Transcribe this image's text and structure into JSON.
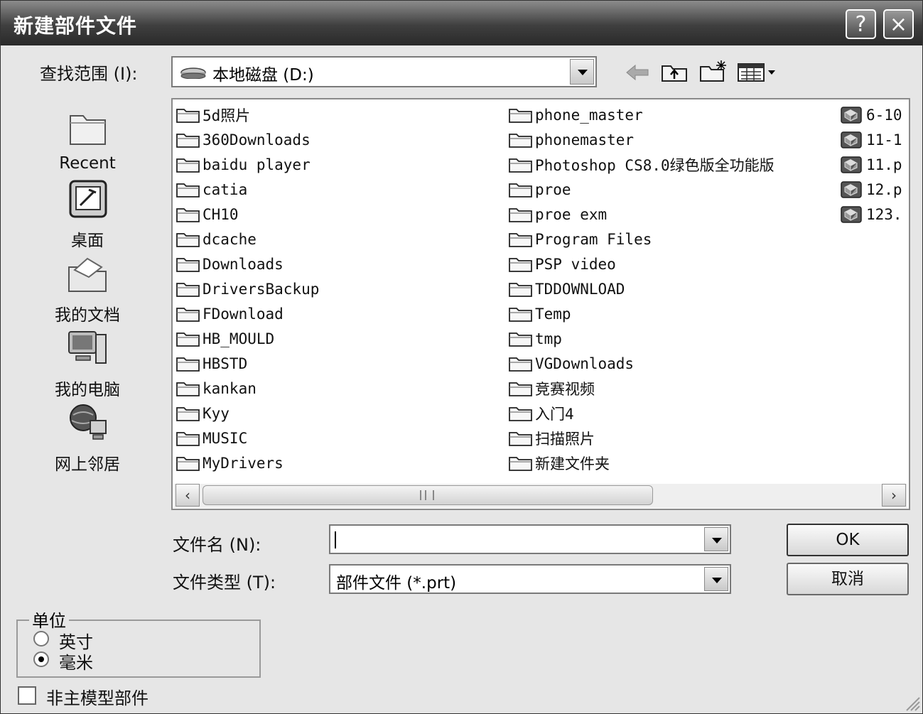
{
  "window": {
    "title": "新建部件文件",
    "help_label": "?",
    "close_label": "×"
  },
  "lookin": {
    "label": "查找范围 (I):",
    "value": "本地磁盘  (D:)"
  },
  "toolbar": {
    "back_icon": "back-arrow-icon",
    "up_icon": "up-folder-icon",
    "newfolder_icon": "new-folder-icon",
    "views_icon": "view-menu-icon"
  },
  "places": [
    {
      "label": "Recent",
      "icon": "recent-folder-icon"
    },
    {
      "label": "桌面",
      "icon": "desktop-icon"
    },
    {
      "label": "我的文档",
      "icon": "my-documents-icon"
    },
    {
      "label": "我的电脑",
      "icon": "my-computer-icon"
    },
    {
      "label": "网上邻居",
      "icon": "network-icon"
    }
  ],
  "files": {
    "col1": [
      "5d照片",
      "360Downloads",
      "baidu player",
      "catia",
      "CH10",
      "dcache",
      "Downloads",
      "DriversBackup",
      "FDownload",
      "HB_MOULD",
      "HBSTD",
      "kankan",
      "Kyy",
      "MUSIC",
      "MyDrivers"
    ],
    "col2": [
      "phone_master",
      "phonemaster",
      "Photoshop CS8.0绿色版全功能版",
      "proe",
      "proe exm",
      "Program Files",
      "PSP video",
      "TDDOWNLOAD",
      "Temp",
      "tmp",
      "VGDownloads",
      "竞赛视频",
      "入门4",
      "扫描照片",
      "新建文件夹"
    ],
    "col3": [
      "6-10",
      "11-1",
      "11.p",
      "12.p",
      "123."
    ]
  },
  "filename": {
    "label": "文件名 (N):",
    "value": ""
  },
  "filetype": {
    "label": "文件类型 (T):",
    "value": "部件文件  (*.prt)"
  },
  "buttons": {
    "ok": "OK",
    "cancel": "取消"
  },
  "units": {
    "legend": "单位",
    "inch": "英寸",
    "mm": "毫米",
    "selected": "毫米"
  },
  "non_master": {
    "label": "非主模型部件",
    "checked": false
  }
}
